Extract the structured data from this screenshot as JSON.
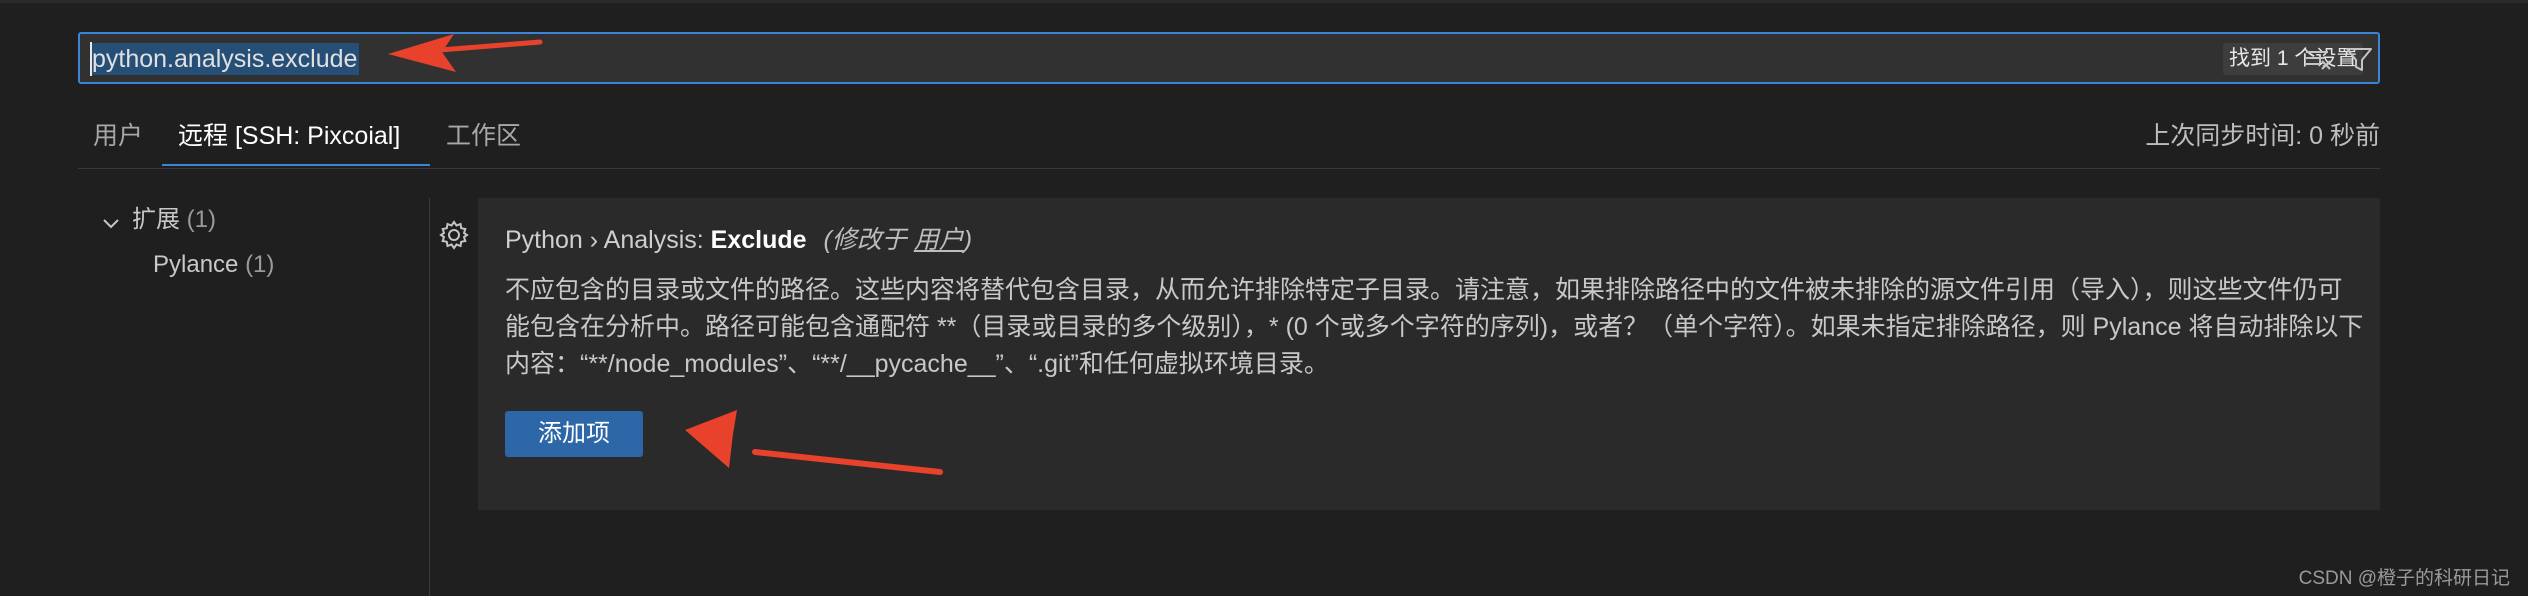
{
  "search": {
    "value": "python.analysis.exclude",
    "result_count": "找到 1 个设置"
  },
  "tabs": [
    {
      "label": "用户",
      "active": false
    },
    {
      "label": "远程 [SSH: Pixcoial]",
      "active": true
    },
    {
      "label": "工作区",
      "active": false
    }
  ],
  "sync_status": "上次同步时间: 0 秒前",
  "tree": {
    "extensions": {
      "label": "扩展",
      "count": "(1)"
    },
    "pylance": {
      "label": "Pylance",
      "count": "(1)"
    }
  },
  "setting": {
    "breadcrumb": "Python › Analysis: ",
    "key": "Exclude",
    "modified_prefix": "(修改于 ",
    "modified_link": "用户",
    "modified_suffix": ")",
    "description": "不应包含的目录或文件的路径。这些内容将替代包含目录，从而允许排除特定子目录。请注意，如果排除路径中的文件被未排除的源文件引用（导入），则这些文件仍可能包含在分析中。路径可能包含通配符 **（目录或目录的多个级别），* (0 个或多个字符的序列)，或者？（单个字符）。如果未指定排除路径，则 Pylance 将自动排除以下内容：“**/node_modules”、“**/__pycache__”、“.git”和任何虚拟环境目录。",
    "add_button_label": "添加项"
  },
  "watermark": "CSDN @橙子的科研日记",
  "colors": {
    "background": "#1f1f1f",
    "accent": "#3b84d8",
    "button": "#2d67a8",
    "annotation_arrow": "#e8412c"
  },
  "icons": [
    "filter-lines-icon",
    "funnel-icon",
    "chevron-down-icon",
    "gear-icon",
    "annotation-arrow"
  ]
}
